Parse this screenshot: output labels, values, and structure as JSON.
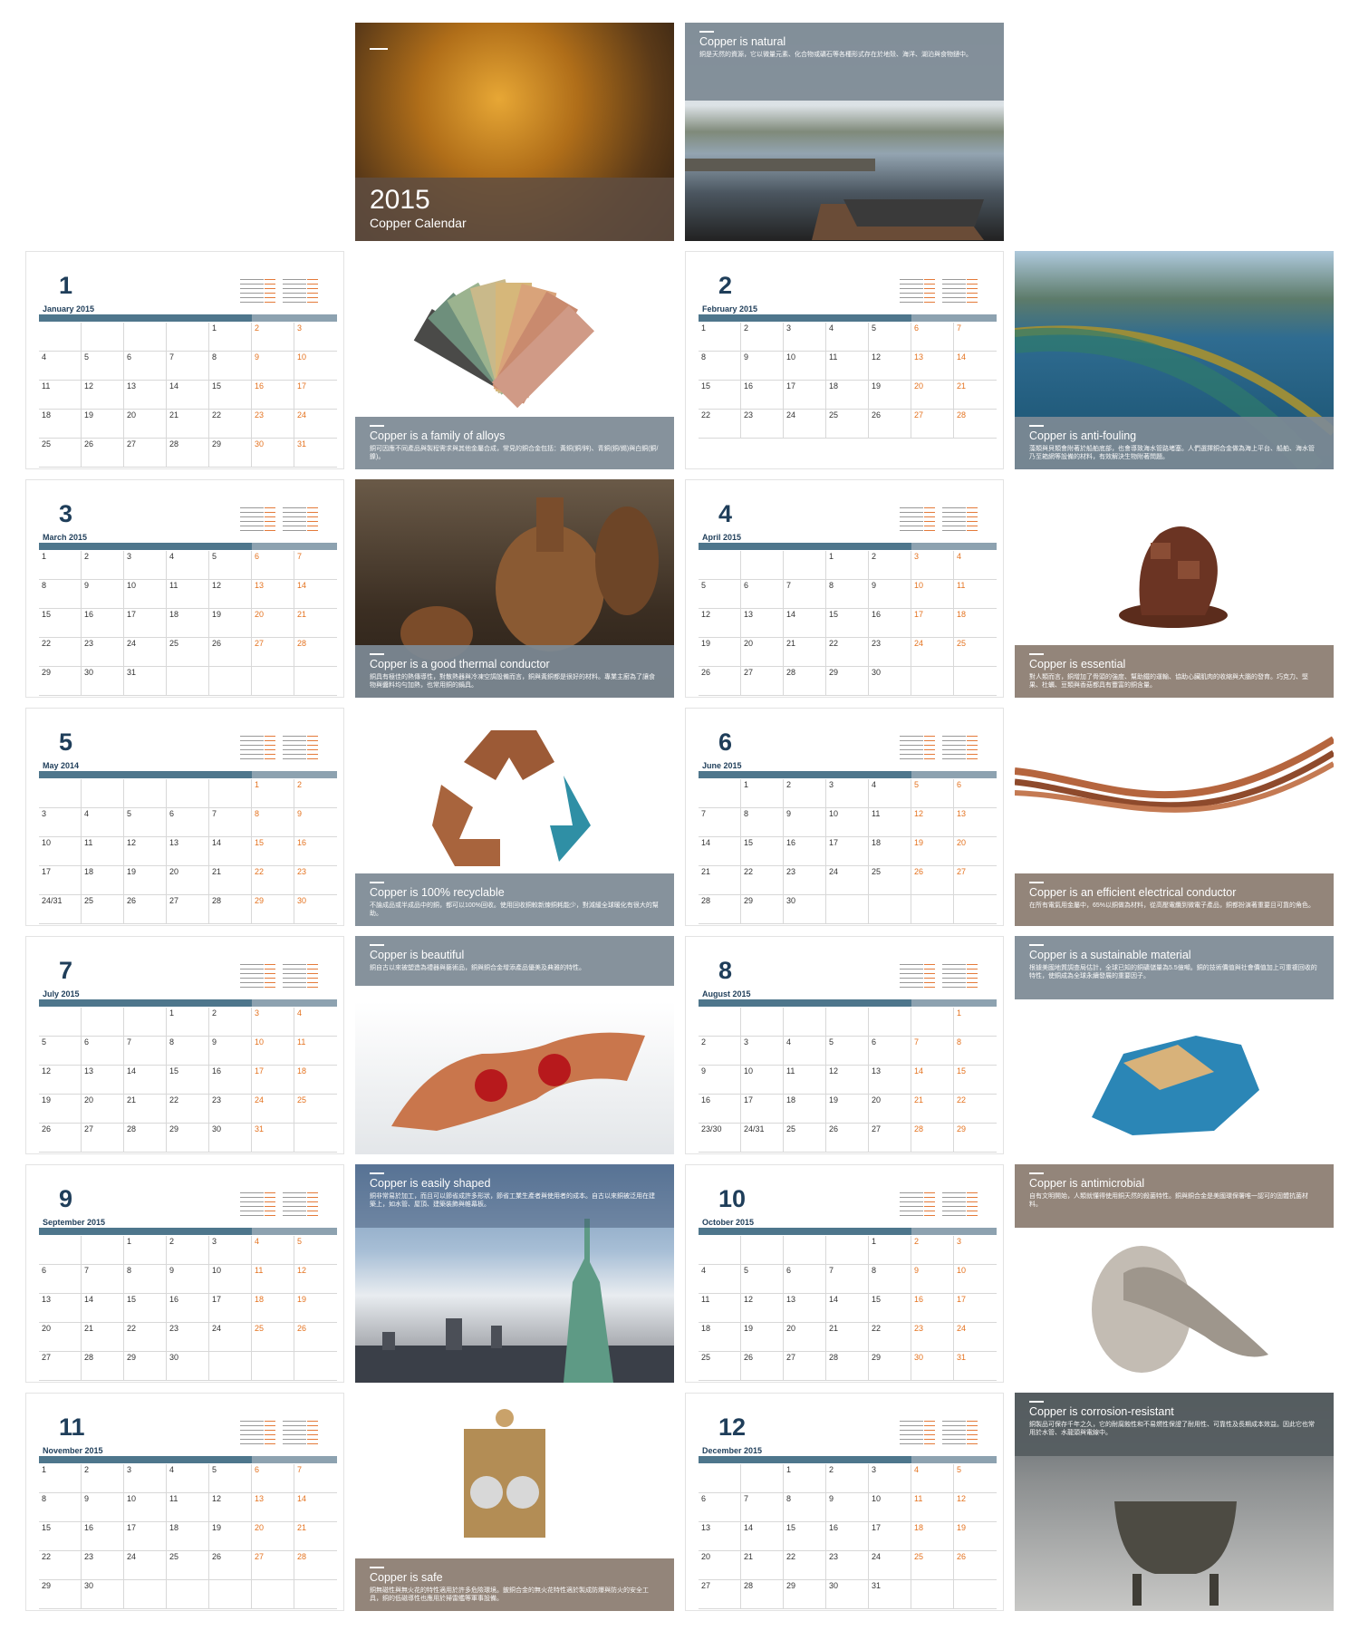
{
  "cover": {
    "year": "2015",
    "title": "Copper Calendar"
  },
  "intro": {
    "title": "Copper is natural",
    "text": "銅是天然的資源，它以微量元素、化合物或礦石等各種形式存在於地殼、海洋、湖泊與食物鏈中。"
  },
  "months": [
    {
      "num": "1",
      "name": "January 2015",
      "start": 4,
      "days": 31
    },
    {
      "num": "2",
      "name": "February 2015",
      "start": 0,
      "days": 28
    },
    {
      "num": "3",
      "name": "March 2015",
      "start": 0,
      "days": 31
    },
    {
      "num": "4",
      "name": "April 2015",
      "start": 3,
      "days": 30
    },
    {
      "num": "5",
      "name": "May 2014",
      "start": 5,
      "days": 31
    },
    {
      "num": "6",
      "name": "June 2015",
      "start": 1,
      "days": 30
    },
    {
      "num": "7",
      "name": "July 2015",
      "start": 3,
      "days": 31
    },
    {
      "num": "8",
      "name": "August 2015",
      "start": 6,
      "days": 31
    },
    {
      "num": "9",
      "name": "September 2015",
      "start": 2,
      "days": 30
    },
    {
      "num": "10",
      "name": "October 2015",
      "start": 4,
      "days": 31
    },
    {
      "num": "11",
      "name": "November 2015",
      "start": 0,
      "days": 30
    },
    {
      "num": "12",
      "name": "December 2015",
      "start": 2,
      "days": 31
    }
  ],
  "captions": [
    {
      "title": "Copper is a family of alloys",
      "text": "銅可因應不同產品與製程需求與其他金屬合成，常見的銅合金包括：黃銅(銅/鋅)、青銅(銅/錫)與白銅(銅/鎳)。"
    },
    {
      "title": "Copper is anti-fouling",
      "text": "藻類與貝類會附著於船舶底部，也會導致海水管路堵塞。人們選擇銅合金做為海上平台、船舶、海水管乃至箱網等設備的材料，有效解決生物附著問題。"
    },
    {
      "title": "Copper is a good thermal conductor",
      "text": "銅具有極佳的熱傳導性，對散熱器與冷凍空調設備而言，銅與黃銅都是很好的材料。專業主廚為了讓食物與醬料均勻加熱，也常用銅的鍋具。"
    },
    {
      "title": "Copper is essential",
      "text": "對人類而言，銅增加了骨頭的強度、幫助鐵的運輸、協助心臟肌肉的收縮與大腦的發育。巧克力、堅果、杜蠣、豆類與香菇都具有豐富的銅含量。"
    },
    {
      "title": "Copper is 100% recyclable",
      "text": "不論成品或半成品中的銅，都可以100%回收。使用回收銅較新煉銅耗能少，對減緩全球暖化有很大的幫助。"
    },
    {
      "title": "Copper is an efficient electrical conductor",
      "text": "在所有電氣用金屬中，65%以銅做為材料，從高壓電纜到微電子產品，銅都扮演著重要且可靠的角色。"
    },
    {
      "title": "Copper is beautiful",
      "text": "銅自古以來被塑造為禮器與藝術品，銅與銅合金增添產品優美及典雅的特性。"
    },
    {
      "title": "Copper is a sustainable material",
      "text": "根據美國地質調查局估計，全球已知的銅礦儲量為5.5億噸。銅的技術價值與社會價值加上可重複回收的特性，使銅成為全球永續發展的重要因子。"
    },
    {
      "title": "Copper is easily shaped",
      "text": "銅非常易於加工，而且可以節省成許多形狀，節省工業生產者與使用者的成本。自古以來銅被泛用在建築上，如水管、屋頂、建築裝飾與帷幕板。"
    },
    {
      "title": "Copper is antimicrobial",
      "text": "自有文明開始，人類就懂得使用銅天然的殺菌特性。銅與銅合金是美國環保署唯一認可的固體抗菌材料。"
    },
    {
      "title": "Copper is safe",
      "text": "銅無磁性與無火花的特性適用於許多危險環境。鈹銅合金的無火花特性適於製成防爆與防火的安全工具，銅的低磁導性也應用於掃雷艦等軍事設備。"
    },
    {
      "title": "Copper is corrosion-resistant",
      "text": "銅製品可保存千年之久，它的耐腐蝕性和不易燃性保證了耐用性、可靠性及長期成本效益。因此它也常用於水管、水龍頭與電線中。"
    }
  ],
  "colors": {
    "navy": "#1f3e5a",
    "bar": "#4e768c",
    "weekend": "#e4721f"
  }
}
